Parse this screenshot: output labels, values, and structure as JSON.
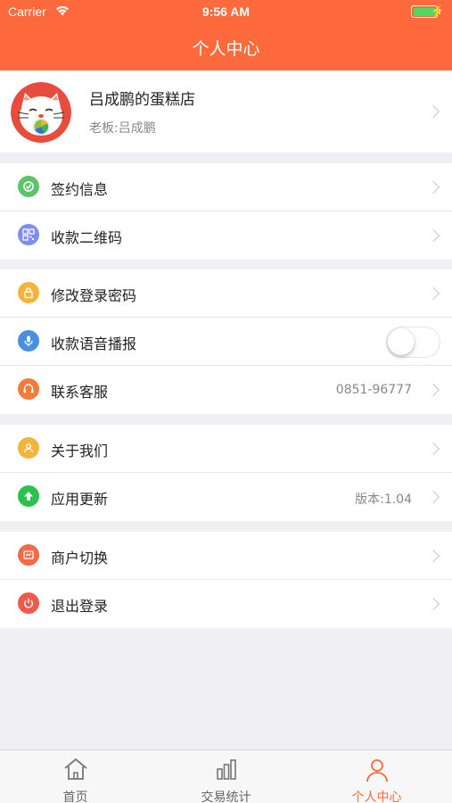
{
  "status_bar": {
    "carrier": "Carrier",
    "time": "9:56 AM"
  },
  "header": {
    "title": "个人中心"
  },
  "profile": {
    "store_name": "吕成鹏的蛋糕店",
    "owner_label": "老板:",
    "owner_name": "吕成鹏"
  },
  "menu": {
    "contract": {
      "label": "签约信息",
      "icon": "contract-icon",
      "color": "#5cc46b"
    },
    "qrcode": {
      "label": "收款二维码",
      "icon": "qrcode-icon",
      "color": "#7f8cf2"
    },
    "password": {
      "label": "修改登录密码",
      "icon": "lock-icon",
      "color": "#f4b33a"
    },
    "voice": {
      "label": "收款语音播报",
      "icon": "microphone-icon",
      "color": "#4a90e2",
      "enabled": false
    },
    "service": {
      "label": "联系客服",
      "value": "0851-96777",
      "icon": "headset-icon",
      "color": "#f47b3a"
    },
    "about": {
      "label": "关于我们",
      "icon": "people-icon",
      "color": "#f4b33a"
    },
    "update": {
      "label": "应用更新",
      "value": "版本:1.04",
      "icon": "upload-icon",
      "color": "#2bc14c"
    },
    "switch": {
      "label": "商户切换",
      "icon": "store-switch-icon",
      "color": "#f26a47"
    },
    "logout": {
      "label": "退出登录",
      "icon": "power-icon",
      "color": "#f05a4a"
    }
  },
  "tabbar": {
    "home": {
      "label": "首页",
      "icon": "home-icon"
    },
    "stats": {
      "label": "交易统计",
      "icon": "bar-chart-icon"
    },
    "profile": {
      "label": "个人中心",
      "icon": "person-icon",
      "active": true
    }
  },
  "colors": {
    "accent": "#ff6a3c",
    "background": "#efeff4"
  }
}
